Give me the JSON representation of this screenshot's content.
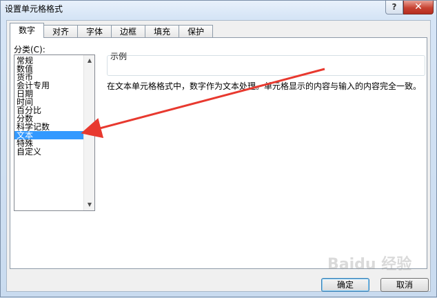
{
  "window": {
    "title": "设置单元格格式",
    "help_glyph": "?",
    "close_glyph": "✕"
  },
  "tabs": [
    "数字",
    "对齐",
    "字体",
    "边框",
    "填充",
    "保护"
  ],
  "active_tab": "数字",
  "category": {
    "label": "分类(C):",
    "items": [
      "常规",
      "数值",
      "货币",
      "会计专用",
      "日期",
      "时间",
      "百分比",
      "分数",
      "科学记数",
      "文本",
      "特殊",
      "自定义"
    ],
    "selected": "文本"
  },
  "sample": {
    "label": "示例"
  },
  "description": "在文本单元格格式中，数字作为文本处理。单元格显示的内容与输入的内容完全一致。",
  "buttons": {
    "ok": "确定",
    "cancel": "取消"
  },
  "watermark": "Baidu 经验",
  "colors": {
    "selection": "#3399ff",
    "annotation_arrow": "#e8392f",
    "close_button": "#c74232"
  }
}
